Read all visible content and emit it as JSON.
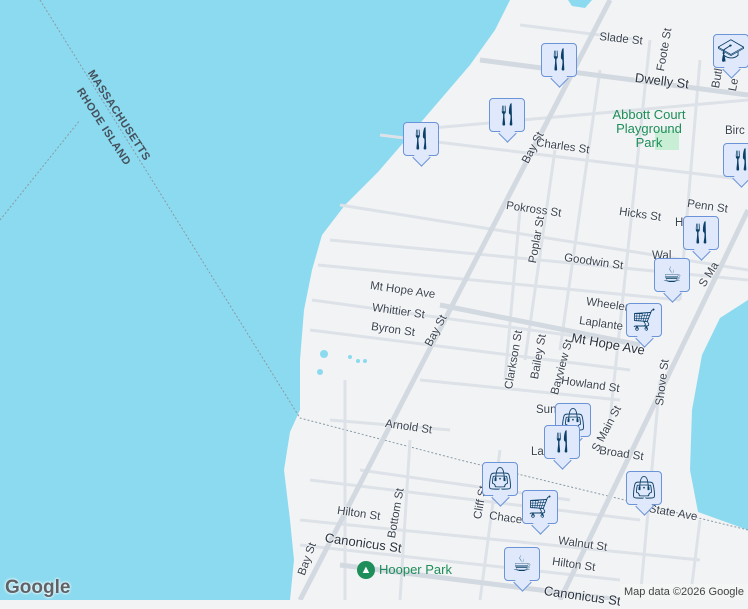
{
  "colors": {
    "water": "#8cdaef",
    "land": "#f2f3f4",
    "road": "#d7dde4",
    "pin_bg": "#dfe9fb",
    "pin_icon": "#0d4068",
    "park": "#1e8e5a"
  },
  "state_labels": {
    "massachusetts": "MASSACHUSETTS",
    "rhode_island": "RHODE ISLAND"
  },
  "streets": [
    "Slade St",
    "Foote St",
    "Dwelly St",
    "Butl",
    "Le",
    "Bay St",
    "Charles St",
    "Birc",
    "Pokross St",
    "Hicks St",
    "Penn St",
    "H",
    "Poplar St",
    "Goodwin St",
    "Wal",
    "S Ma",
    "Mt Hope Ave",
    "Whittier St",
    "Byron St",
    "Bay St",
    "Wheeler",
    "Laplante",
    "Mt Hope Ave",
    "Clarkson St",
    "Bailey St",
    "Bayview St",
    "Howland St",
    "Shove St",
    "Sun",
    "Arnold St",
    "Broad St",
    "La",
    "S Main St",
    "Cliff St",
    "Chace",
    "State Ave",
    "Walnut St",
    "Hilton St",
    "Bottom St",
    "Hilton St",
    "Canonicus St",
    "Canonicus St",
    "Bay St"
  ],
  "parks": {
    "abbott": "Abbott Court Playground Park",
    "hooper": "Hooper Park"
  },
  "markers": [
    {
      "type": "restaurant",
      "icon": "fork-knife-icon"
    },
    {
      "type": "restaurant",
      "icon": "fork-knife-icon"
    },
    {
      "type": "restaurant",
      "icon": "fork-knife-icon"
    },
    {
      "type": "school",
      "icon": "graduation-cap-icon"
    },
    {
      "type": "restaurant",
      "icon": "fork-knife-icon"
    },
    {
      "type": "restaurant",
      "icon": "fork-knife-icon"
    },
    {
      "type": "cafe",
      "icon": "coffee-cup-icon"
    },
    {
      "type": "grocery",
      "icon": "shopping-cart-icon"
    },
    {
      "type": "shopping",
      "icon": "shopping-bag-icon"
    },
    {
      "type": "restaurant",
      "icon": "fork-knife-icon"
    },
    {
      "type": "shopping",
      "icon": "shopping-bag-icon"
    },
    {
      "type": "grocery",
      "icon": "shopping-cart-icon"
    },
    {
      "type": "shopping",
      "icon": "shopping-bag-icon"
    },
    {
      "type": "cafe",
      "icon": "coffee-cup-icon"
    }
  ],
  "logo": "Google",
  "attribution": "Map data ©2026 Google"
}
